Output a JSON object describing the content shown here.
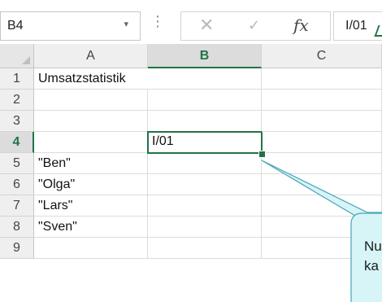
{
  "name_box": {
    "value": "B4",
    "dropdown_glyph": "▾"
  },
  "formula_bar": {
    "options_glyph": "⋮",
    "cancel_glyph": "✕",
    "enter_glyph": "✓",
    "insert_function_label": "fx",
    "value": "I/01"
  },
  "columns": [
    "A",
    "B",
    "C"
  ],
  "selected_column": "B",
  "rows": [
    {
      "num": "1",
      "a": "Umsatzstatistik",
      "b": ""
    },
    {
      "num": "2",
      "a": "",
      "b": ""
    },
    {
      "num": "3",
      "a": "",
      "b": ""
    },
    {
      "num": "4",
      "a": "",
      "b": "I/01"
    },
    {
      "num": "5",
      "a": "\"Ben\"",
      "b": ""
    },
    {
      "num": "6",
      "a": "\"Olga\"",
      "b": ""
    },
    {
      "num": "7",
      "a": "\"Lars\"",
      "b": ""
    },
    {
      "num": "8",
      "a": "\"Sven\"",
      "b": ""
    },
    {
      "num": "9",
      "a": "",
      "b": ""
    }
  ],
  "active_cell": "B4",
  "callout": {
    "line1": "Nu",
    "line2": "ka"
  },
  "colors": {
    "accent": "#217346",
    "callout_fill": "#d7f4f6",
    "callout_border": "#49a5b8"
  },
  "icons": [
    "dropdown-arrow-icon",
    "cancel-icon",
    "enter-icon",
    "insert-function-icon",
    "select-all-icon"
  ]
}
